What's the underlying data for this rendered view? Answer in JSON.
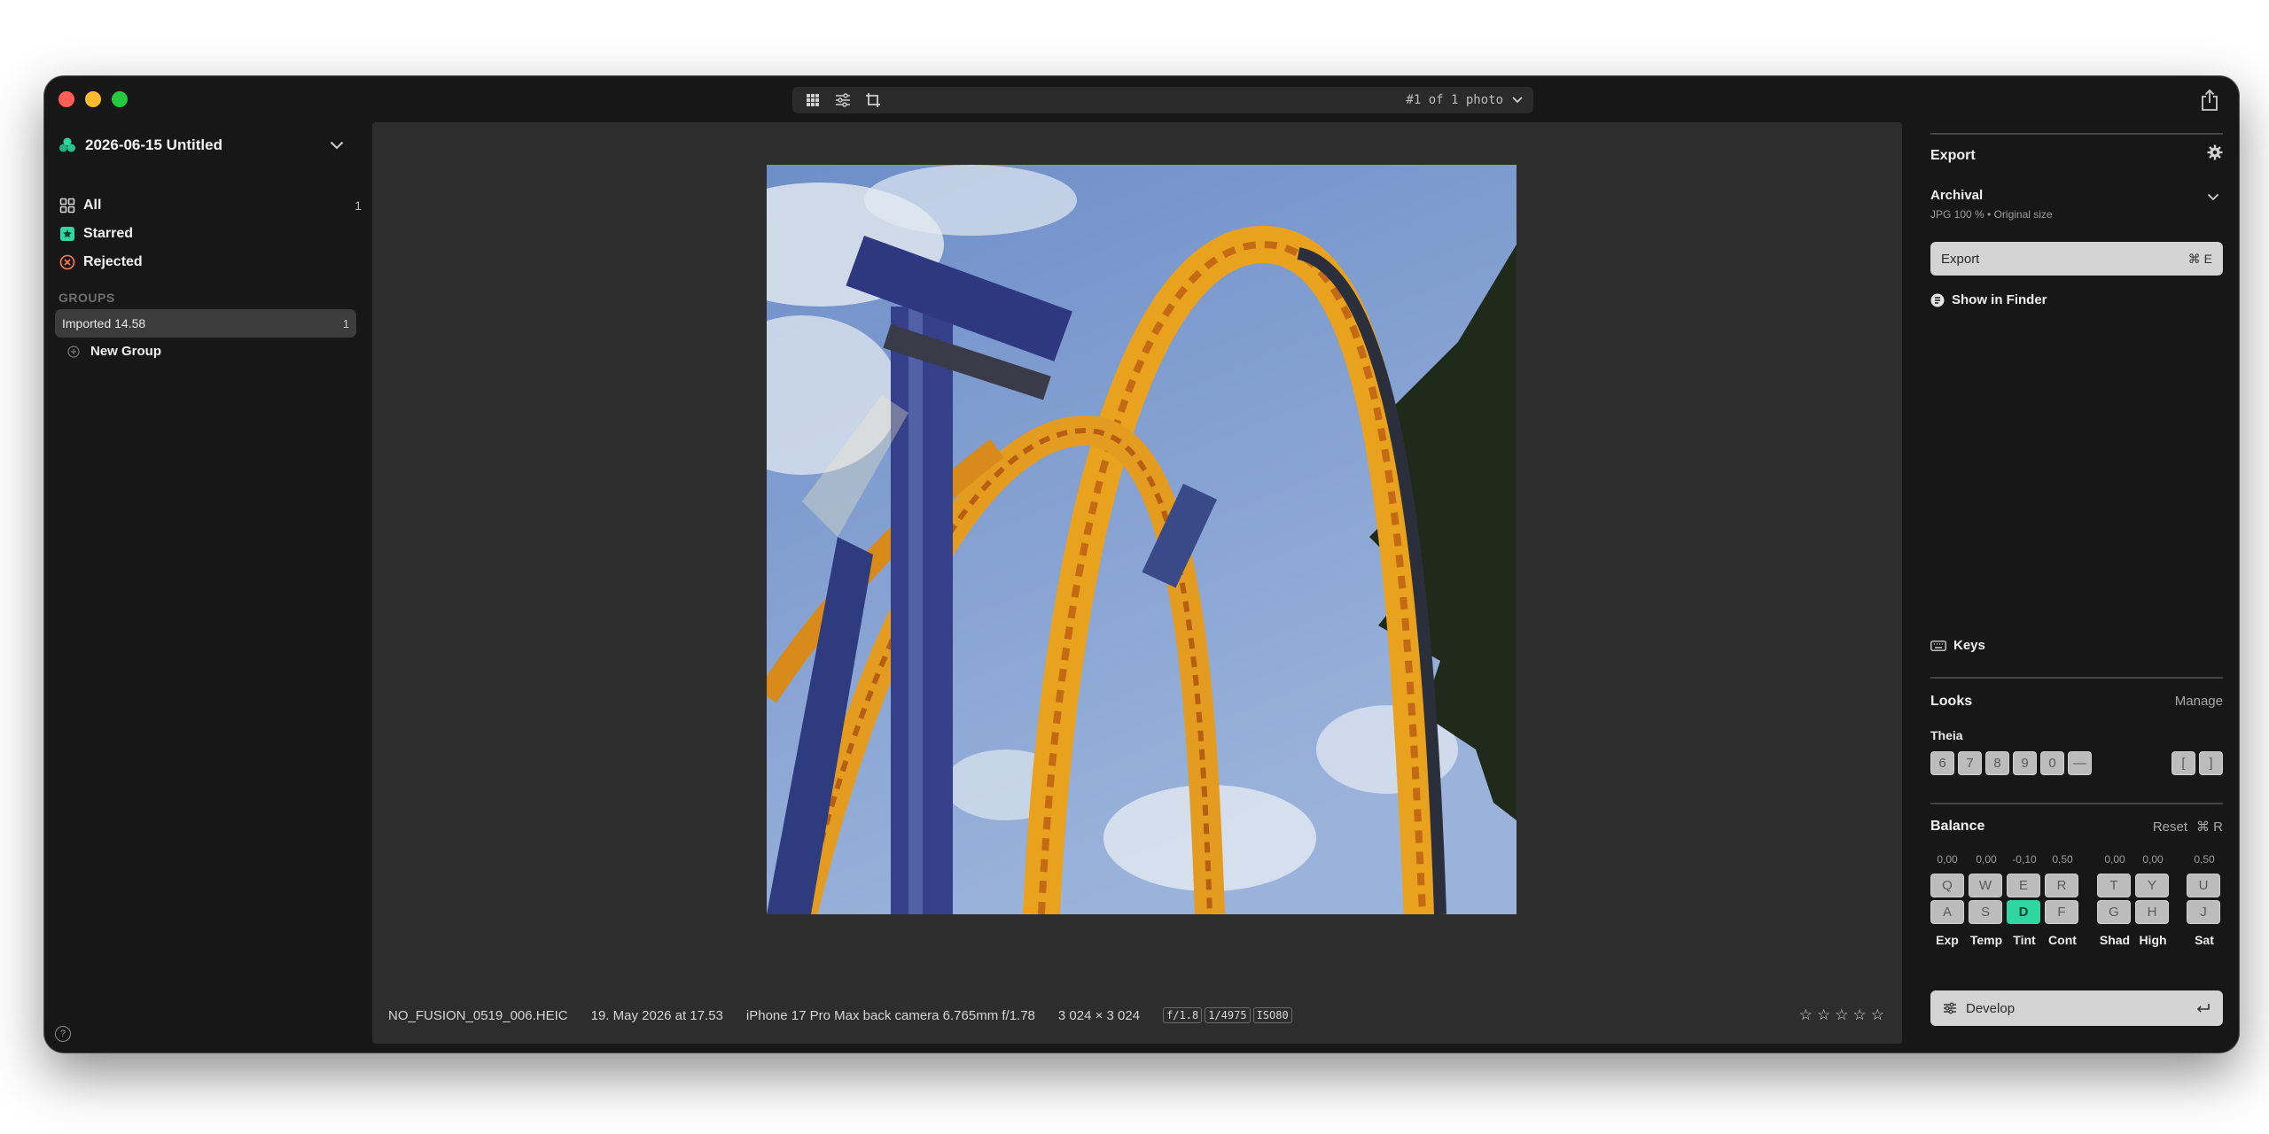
{
  "window": {
    "toolbar": {
      "photo_count": "#1 of 1 photo"
    }
  },
  "sidebar": {
    "library_title": "2026-06-15 Untitled",
    "filters": [
      {
        "label": "All",
        "count": "1",
        "icon": "grid-icon"
      },
      {
        "label": "Starred",
        "icon": "star-badge-icon"
      },
      {
        "label": "Rejected",
        "icon": "reject-icon"
      }
    ],
    "groups_heading": "GROUPS",
    "groups": [
      {
        "label": "Imported 14.58",
        "count": "1"
      }
    ],
    "new_group_label": "New Group",
    "help_label": "?"
  },
  "photo": {
    "description_icon": "roller-coaster-photo"
  },
  "meta": {
    "filename": "NO_FUSION_0519_006.HEIC",
    "date": "19. May 2026 at 17.53",
    "camera": "iPhone 17 Pro Max back camera 6.765mm f/1.78",
    "dimensions": "3 024 × 3 024",
    "aperture": "f/1.8",
    "shutter": "1/4975",
    "iso": "ISO80",
    "rating_stars": [
      "☆",
      "☆",
      "☆",
      "☆",
      "☆"
    ]
  },
  "export": {
    "title": "Export",
    "preset_name": "Archival",
    "preset_detail": "JPG 100 % • Original size",
    "button_label": "Export",
    "button_shortcut": "⌘ E",
    "show_in_finder": "Show in Finder"
  },
  "keys_label": "Keys",
  "looks": {
    "title": "Looks",
    "manage_label": "Manage",
    "set_name": "Theia",
    "keys": [
      "6",
      "7",
      "8",
      "9",
      "0",
      "—"
    ],
    "nav_keys": [
      "[",
      "]"
    ]
  },
  "balance": {
    "title": "Balance",
    "reset_label": "Reset",
    "reset_shortcut": "⌘ R",
    "columns": [
      {
        "value": "0,00",
        "up": "Q",
        "down": "A",
        "label": "Exp"
      },
      {
        "value": "0,00",
        "up": "W",
        "down": "S",
        "label": "Temp"
      },
      {
        "value": "-0,10",
        "up": "E",
        "down": "D",
        "label": "Tint",
        "active": "down"
      },
      {
        "value": "0,50",
        "up": "R",
        "down": "F",
        "label": "Cont"
      },
      {
        "value": "0,00",
        "up": "T",
        "down": "G",
        "label": "Shad"
      },
      {
        "value": "0,00",
        "up": "Y",
        "down": "H",
        "label": "High"
      },
      {
        "value": "0,50",
        "up": "U",
        "down": "J",
        "label": "Sat"
      }
    ]
  },
  "develop": {
    "button_label": "Develop"
  },
  "colors": {
    "accent": "#2fd6a0",
    "panel": "#171717",
    "canvas": "#2d2d2d"
  }
}
